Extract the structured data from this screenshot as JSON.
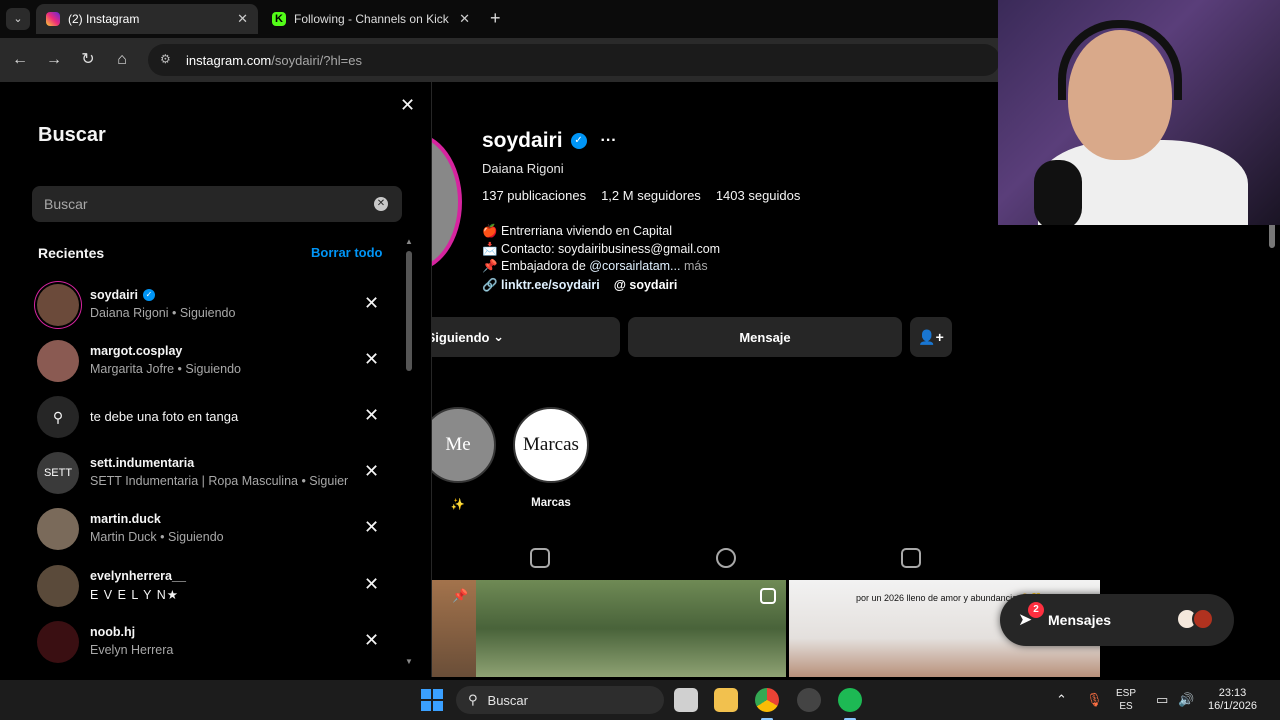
{
  "browser": {
    "tabs": [
      {
        "title": "(2) Instagram",
        "active": true,
        "favicon": "instagram-favicon"
      },
      {
        "title": "Following - Channels on Kick",
        "active": false,
        "favicon": "kick-favicon"
      }
    ],
    "kick_favicon_letter": "K",
    "url_host": "instagram.com",
    "url_path": "/soydairi/?hl=es"
  },
  "search_panel": {
    "title": "Buscar",
    "search_placeholder": "Buscar",
    "search_value": "",
    "recents_title": "Recientes",
    "clear_all": "Borrar todo",
    "items": [
      {
        "type": "user",
        "username": "soydairi",
        "verified": true,
        "subtitle": "Daiana Rigoni • Siguiendo",
        "avatar_color": "#6b4a3a",
        "story": true
      },
      {
        "type": "user",
        "username": "margot.cosplay",
        "verified": false,
        "subtitle": "Margarita Jofre • Siguiendo",
        "avatar_color": "#8a5a52",
        "story": false
      },
      {
        "type": "query",
        "text": "te debe una foto en tanga",
        "icon": "search-icon"
      },
      {
        "type": "user",
        "username": "sett.indumentaria",
        "verified": false,
        "subtitle": "SETT Indumentaria | Ropa Masculina • Siguiendo",
        "avatar_color": "#3a3a3a",
        "avatar_text": "SETT",
        "story": false
      },
      {
        "type": "user",
        "username": "martin.duck",
        "verified": false,
        "subtitle": "Martin Duck • Siguiendo",
        "avatar_color": "#7a6a5a",
        "story": false
      },
      {
        "type": "user",
        "username": "evelynherrera__",
        "verified": false,
        "subtitle": "E V E L Y N★",
        "avatar_color": "#5a4a3a",
        "story": false
      },
      {
        "type": "user",
        "username": "noob.hj",
        "verified": false,
        "subtitle": "Evelyn Herrera",
        "avatar_color": "#3a0f12",
        "story": false
      }
    ]
  },
  "profile": {
    "username": "soydairi",
    "full_name": "Daiana Rigoni",
    "posts": "137 publicaciones",
    "followers": "1,2 M seguidores",
    "following": "1403 seguidos",
    "bio_line1": "🍎 Entrerriana viviendo en Capital",
    "bio_line2": "📩 Contacto: soydairibusiness@gmail.com",
    "bio_line3_prefix": "📌 Embajadora de ",
    "bio_mention": "@corsairlatam...",
    "bio_more": " más",
    "link": "linktr.ee/soydairi",
    "threads_handle": "soydairi",
    "following_button": "Siguiendo",
    "message_button": "Mensaje",
    "highlights": [
      {
        "cover_text": "Me",
        "label": "✨"
      },
      {
        "cover_text": "Marcas",
        "label": "Marcas"
      }
    ],
    "post_caption": "por un 2026 lleno de amor y abundancia ✋🎊"
  },
  "messages_pill": {
    "label": "Mensajes",
    "badge": "2"
  },
  "taskbar": {
    "search_label": "Buscar",
    "lang_top": "ESP",
    "lang_bottom": "ES",
    "time": "23:13",
    "date": "16/1/2026"
  },
  "colors": {
    "accent": "#0095f6",
    "surface": "#262626",
    "story_ring": "#d6249f"
  }
}
